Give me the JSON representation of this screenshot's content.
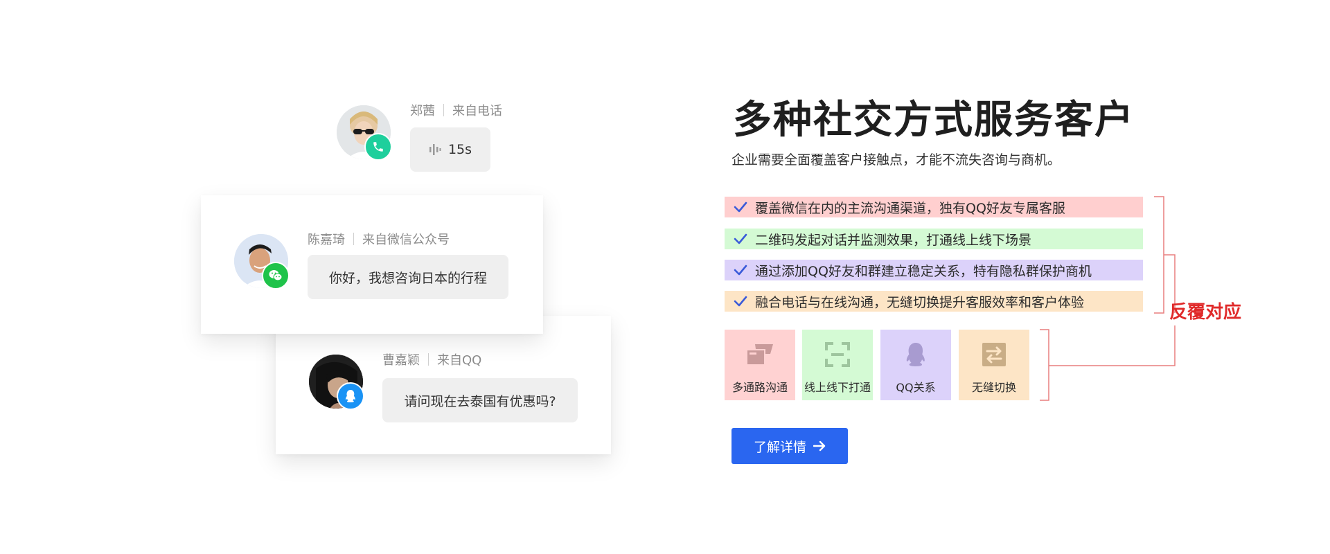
{
  "conversations": [
    {
      "name": "郑茜",
      "source": "来自电话",
      "message": "15s",
      "badge_icon": "phone-icon",
      "badge_color": "#1ecf9c"
    },
    {
      "name": "陈嘉琦",
      "source": "来自微信公众号",
      "message": "你好，我想咨询日本的行程",
      "badge_icon": "wechat-icon",
      "badge_color": "#1fc34a"
    },
    {
      "name": "曹嘉颖",
      "source": "来自QQ",
      "message": "请问现在去泰国有优惠吗?",
      "badge_icon": "qq-icon",
      "badge_color": "#1a93f5"
    }
  ],
  "hero": {
    "title": "多种社交方式服务客户",
    "subtitle": "企业需要全面覆盖客户接触点，才能不流失咨询与商机。"
  },
  "features": [
    {
      "text": "覆盖微信在内的主流沟通渠道，独有QQ好友专属客服",
      "bg": "#ffcfcf"
    },
    {
      "text": "二维码发起对话并监测效果，打通线上线下场景",
      "bg": "#d4fad4"
    },
    {
      "text": "通过添加QQ好友和群建立稳定关系，特有隐私群保护商机",
      "bg": "#dcd2fa"
    },
    {
      "text": "融合电话与在线沟通，无缝切换提升客服效率和客户体验",
      "bg": "#fde5c6"
    }
  ],
  "tiles": [
    {
      "label": "多通路沟通",
      "icon": "multi-channel-icon",
      "bg": "#ffd2d2",
      "icon_color": "#c99a9a"
    },
    {
      "label": "线上线下打通",
      "icon": "qr-scan-icon",
      "bg": "#d4fad4",
      "icon_color": "#9ec59e"
    },
    {
      "label": "QQ关系",
      "icon": "qq-penguin-icon",
      "bg": "#dcd2fa",
      "icon_color": "#a89bd0"
    },
    {
      "label": "无缝切换",
      "icon": "switch-icon",
      "bg": "#fde5c6",
      "icon_color": "#c9ad86"
    }
  ],
  "cta": {
    "label": "了解详情"
  },
  "annotation": {
    "label": "反覆对应",
    "color": "#e02a2a"
  },
  "colors": {
    "check": "#3a5bd9",
    "cta": "#2a66f0"
  }
}
